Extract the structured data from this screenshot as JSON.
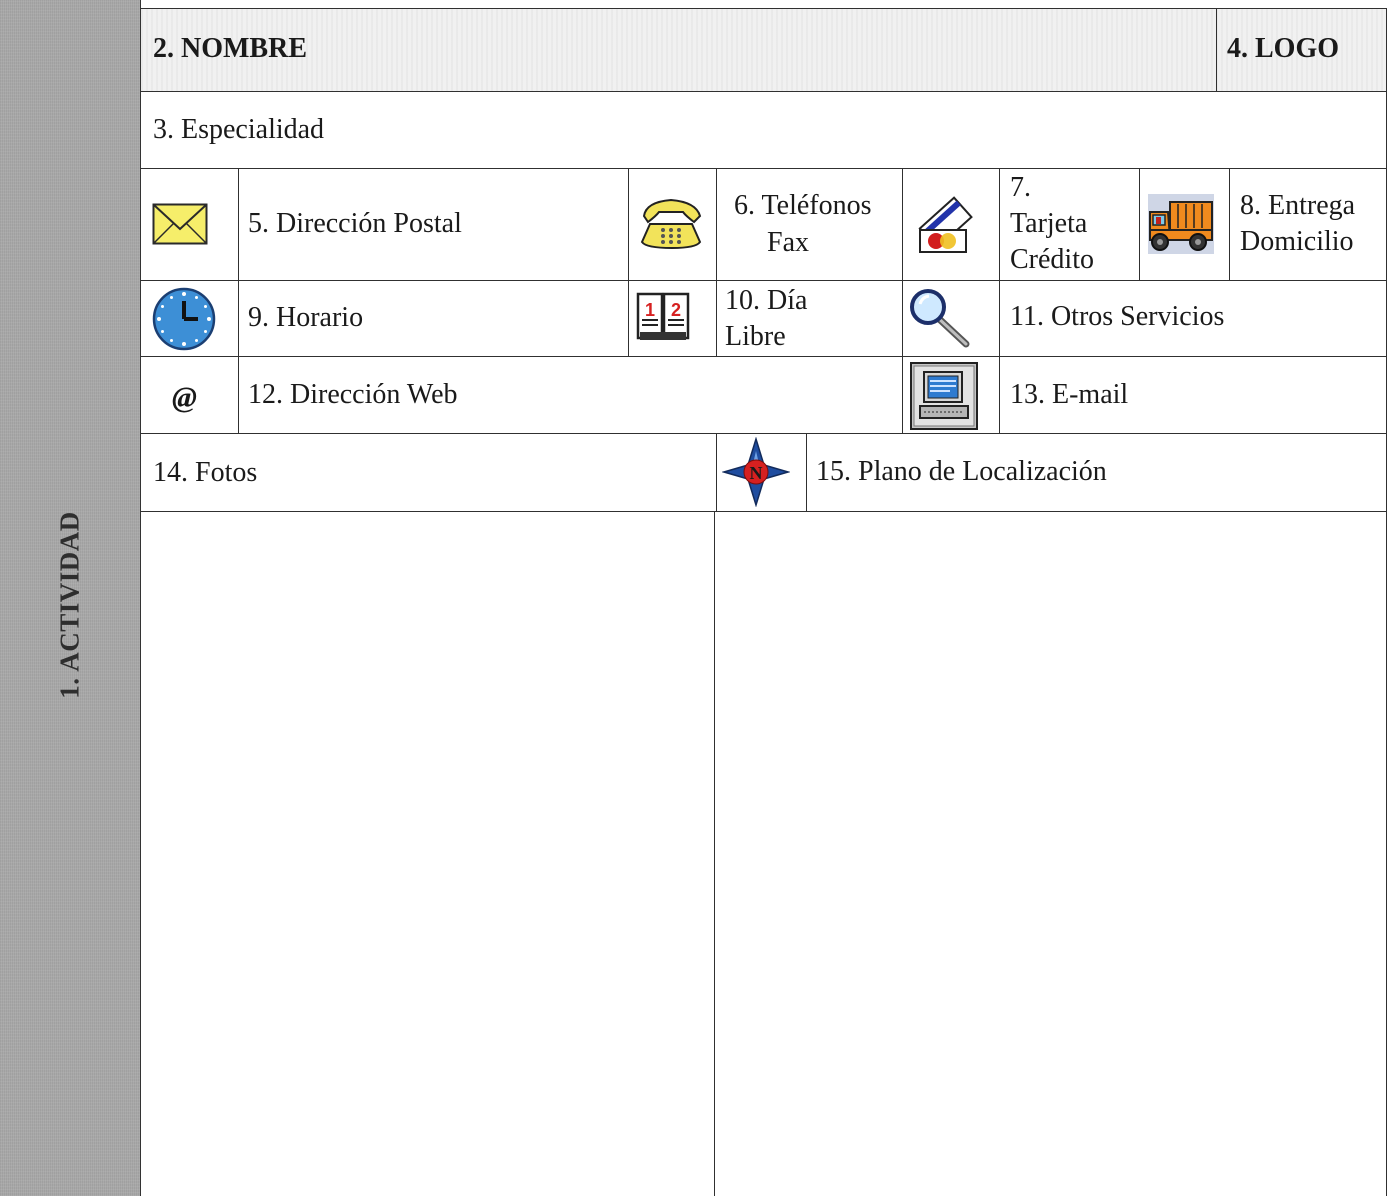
{
  "sidebar": {
    "label": "1. ACTIVIDAD"
  },
  "header": {
    "name_label": "2. NOMBRE",
    "logo_label": "4. LOGO"
  },
  "specialty": {
    "label": "3. Especialidad"
  },
  "services": {
    "postal": "5. Dirección Postal",
    "phones_line1": "6. Teléfonos",
    "phones_line2": "Fax",
    "card_line1": "7.",
    "card_line2": "Tarjeta",
    "card_line3": "Crédito",
    "delivery_line1": "8. Entrega",
    "delivery_line2": "Domicilio",
    "schedule": "9. Horario",
    "dayoff_line1": "10. Día",
    "dayoff_line2": "Libre",
    "other": "11. Otros Servicios",
    "web_symbol": "@",
    "web": "12. Dirección Web",
    "email": "13. E-mail"
  },
  "photos": {
    "label": "14. Fotos"
  },
  "map": {
    "label": "15. Plano de Localización",
    "compass_letter": "N"
  },
  "calendar_icon": {
    "left_digit": "1",
    "right_digit": "2"
  },
  "icons": [
    "envelope-icon",
    "telephone-icon",
    "credit-card-icon",
    "delivery-truck-icon",
    "clock-icon",
    "calendar-icon",
    "magnifier-icon",
    "at-sign-icon",
    "computer-icon",
    "compass-icon"
  ]
}
